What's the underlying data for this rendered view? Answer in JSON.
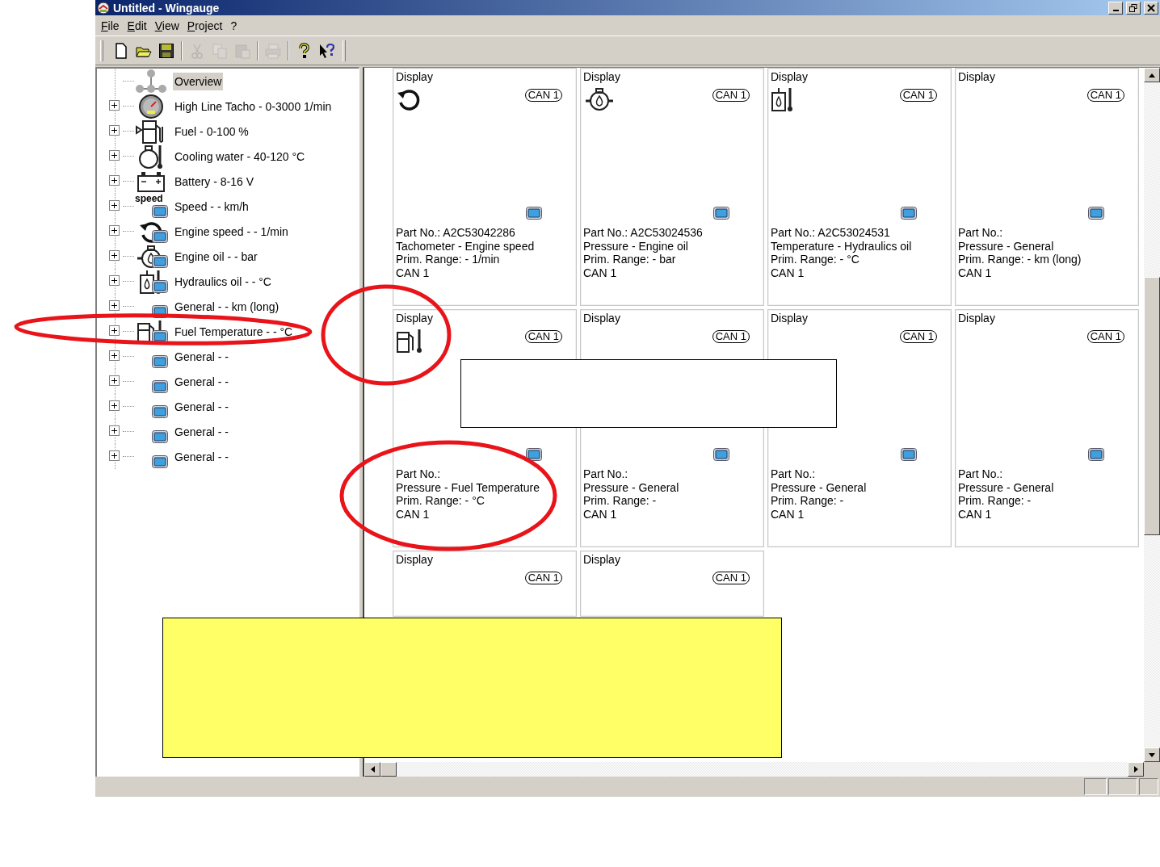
{
  "window": {
    "title": "Untitled - Wingauge"
  },
  "menu": [
    {
      "label": "File"
    },
    {
      "label": "Edit"
    },
    {
      "label": "View"
    },
    {
      "label": "Project"
    },
    {
      "label": "?"
    }
  ],
  "toolbar": [
    {
      "kind": "new",
      "disabled": false
    },
    {
      "kind": "open",
      "disabled": false
    },
    {
      "kind": "save",
      "disabled": false
    },
    {
      "kind": "separator"
    },
    {
      "kind": "cut",
      "disabled": true
    },
    {
      "kind": "copy",
      "disabled": true
    },
    {
      "kind": "paste",
      "disabled": true
    },
    {
      "kind": "separator"
    },
    {
      "kind": "print",
      "disabled": true
    },
    {
      "kind": "separator"
    },
    {
      "kind": "help",
      "disabled": false
    },
    {
      "kind": "context-help",
      "disabled": false
    }
  ],
  "tree": {
    "items": [
      {
        "label": "Overview",
        "kind": "overview",
        "selected": true
      },
      {
        "label": "High Line Tacho - 0-3000 1/min",
        "kind": "tacho",
        "expanded": false,
        "selected": false
      },
      {
        "label": "Fuel - 0-100 %",
        "kind": "fuel",
        "expanded": false,
        "selected": false
      },
      {
        "label": "Cooling water - 40-120 °C",
        "kind": "cooling",
        "expanded": false,
        "selected": false
      },
      {
        "label": "Battery - 8-16 V",
        "kind": "battery",
        "expanded": false,
        "selected": false
      },
      {
        "label": "Speed - - km/h",
        "kind": "speed",
        "icon_label": "speed",
        "expanded": false,
        "selected": false
      },
      {
        "label": "Engine speed - - 1/min",
        "kind": "engine-speed",
        "expanded": false,
        "selected": false
      },
      {
        "label": "Engine oil - - bar",
        "kind": "engine-oil",
        "expanded": false,
        "selected": false
      },
      {
        "label": "Hydraulics oil - - °C",
        "kind": "hydraulics",
        "expanded": false,
        "selected": false
      },
      {
        "label": "General - - km (long)",
        "kind": "general",
        "expanded": false,
        "selected": false
      },
      {
        "label": "Fuel Temperature - - °C",
        "kind": "fuel-temp",
        "expanded": false,
        "selected": false
      },
      {
        "label": "General - -",
        "kind": "general",
        "expanded": false,
        "selected": false
      },
      {
        "label": "General - -",
        "kind": "general",
        "expanded": false,
        "selected": false
      },
      {
        "label": "General - -",
        "kind": "general",
        "expanded": false,
        "selected": false
      },
      {
        "label": "General - -",
        "kind": "general",
        "expanded": false,
        "selected": false
      },
      {
        "label": "General - -",
        "kind": "general",
        "expanded": false,
        "selected": false
      }
    ]
  },
  "cards": [
    {
      "title": "Display",
      "bus_badge": "CAN 1",
      "kind": "engine-speed",
      "lines": [
        "Part No.: A2C53042286",
        "Tachometer - Engine speed",
        "Prim. Range: - 1/min",
        "CAN 1"
      ]
    },
    {
      "title": "Display",
      "bus_badge": "CAN 1",
      "kind": "engine-oil",
      "lines": [
        "Part No.: A2C53024536",
        "Pressure - Engine oil",
        "Prim. Range: - bar",
        "CAN 1"
      ]
    },
    {
      "title": "Display",
      "bus_badge": "CAN 1",
      "kind": "hydraulics",
      "lines": [
        "Part No.: A2C53024531",
        "Temperature - Hydraulics oil",
        "Prim. Range: - °C",
        "CAN 1"
      ]
    },
    {
      "title": "Display",
      "bus_badge": "CAN 1",
      "kind": "general",
      "lines": [
        "Part No.:",
        "Pressure - General",
        "Prim. Range: - km (long)",
        "CAN 1"
      ]
    },
    {
      "title": "Display",
      "bus_badge": "CAN 1",
      "kind": "fuel-temp",
      "lines": [
        "Part No.:",
        "Pressure - Fuel Temperature",
        "Prim. Range: - °C",
        "CAN 1"
      ]
    },
    {
      "title": "Display",
      "bus_badge": "CAN 1",
      "kind": "general",
      "lines": [
        "Part No.:",
        "Pressure - General",
        "Prim. Range: -",
        "CAN 1"
      ]
    },
    {
      "title": "Display",
      "bus_badge": "CAN 1",
      "kind": "general",
      "lines": [
        "Part No.:",
        "Pressure - General",
        "Prim. Range: -",
        "CAN 1"
      ]
    },
    {
      "title": "Display",
      "bus_badge": "CAN 1",
      "kind": "general",
      "lines": [
        "Part No.:",
        "Pressure - General",
        "Prim. Range: -",
        "CAN 1"
      ]
    },
    {
      "title": "Display",
      "bus_badge": "CAN 1",
      "kind": "general"
    },
    {
      "title": "Display",
      "bus_badge": "CAN 1",
      "kind": "general"
    }
  ]
}
